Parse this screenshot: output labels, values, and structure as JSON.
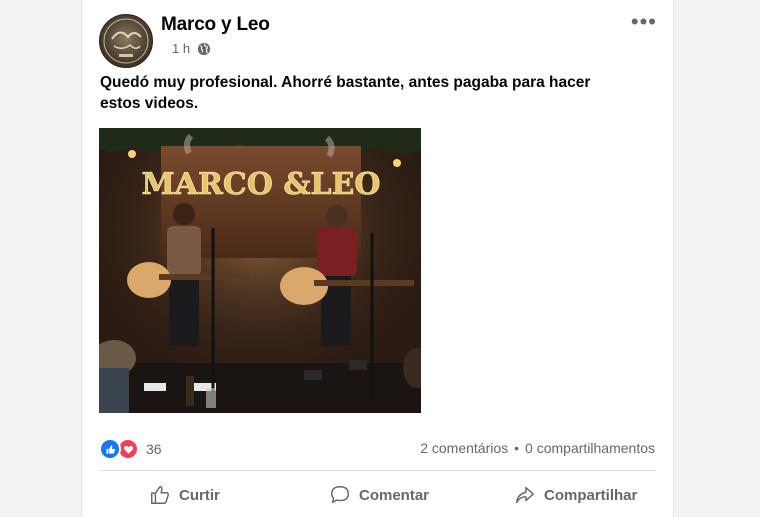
{
  "post": {
    "page_name": "Marco y Leo",
    "time": "1 h",
    "privacy_icon": "globe-icon",
    "more_icon": "•••",
    "text": "Quedó muy profesional. Ahorré bastante, antes pagaba para hacer estos videos.",
    "image_sign": "MARCO &LEO",
    "avatar_text": "Marco & Leo"
  },
  "engagement": {
    "reaction_icons": [
      "like-icon",
      "love-icon"
    ],
    "reaction_count": "36",
    "comments": "2 comentários",
    "separator": "•",
    "shares": "0 compartilhamentos"
  },
  "actions": {
    "like": "Curtir",
    "comment": "Comentar",
    "share": "Compartilhar"
  },
  "colors": {
    "like": "#1877f2",
    "love": "#f33e58",
    "muted": "#65676b"
  }
}
